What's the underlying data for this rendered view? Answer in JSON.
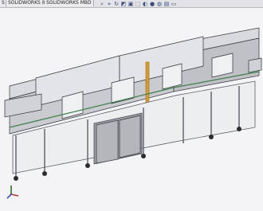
{
  "app": {
    "tabs": [
      {
        "label": "S"
      },
      {
        "label": "SOLIDWORKS 插件"
      },
      {
        "label": "SOLIDWORKS MBD"
      }
    ]
  },
  "toolbar": {
    "icons": [
      "zoom-fit-icon",
      "zoom-area-icon",
      "rotate-icon",
      "section-view-icon",
      "display-style-icon",
      "view-orientation-icon",
      "hide-show-icon",
      "appearance-icon",
      "scene-icon",
      "view-settings-icon",
      "monitor-icon"
    ]
  },
  "model": {
    "description_color": "#8c8e94",
    "accent_bar_color": "#d29a3a"
  }
}
